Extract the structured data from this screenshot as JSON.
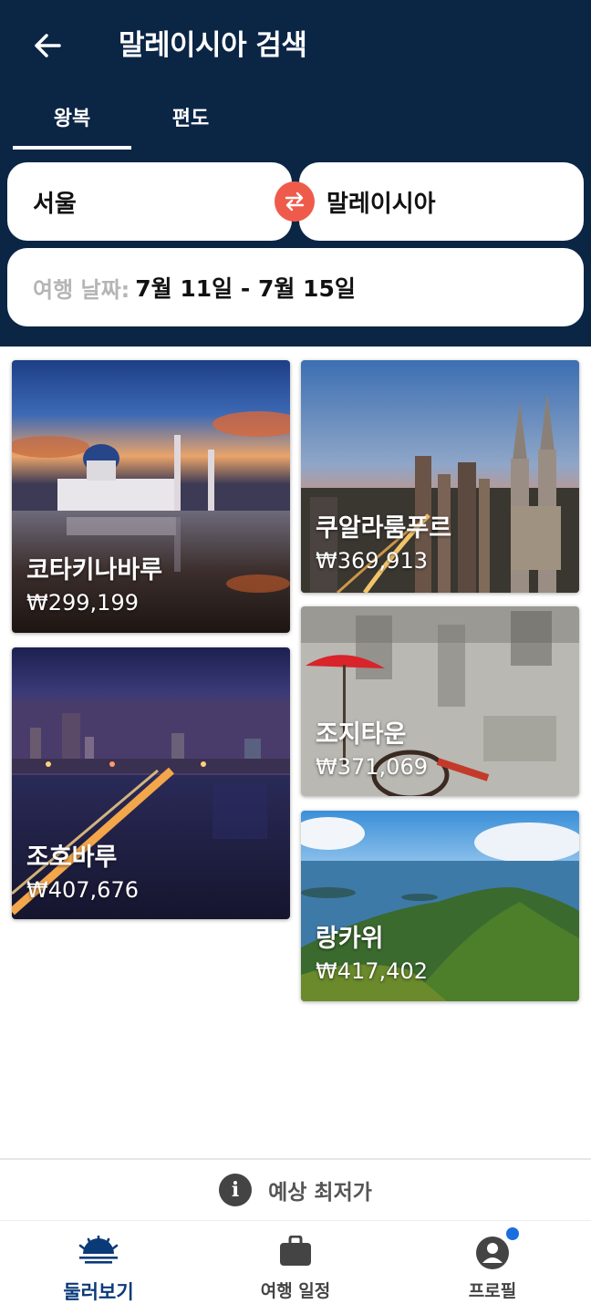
{
  "header": {
    "title": "말레이시아 검색",
    "tabs": [
      {
        "label": "왕복",
        "selected": true
      },
      {
        "label": "편도",
        "selected": false
      }
    ]
  },
  "search": {
    "origin": "서울",
    "destination": "말레이시아",
    "date_label": "여행 날짜:",
    "date_value": "7월 11일 - 7월 15일"
  },
  "destinations": [
    {
      "city": "코타키나바루",
      "price": "₩299,199"
    },
    {
      "city": "쿠알라룸푸르",
      "price": "₩369,913"
    },
    {
      "city": "조호바루",
      "price": "₩407,676"
    },
    {
      "city": "조지타운",
      "price": "₩371,069"
    },
    {
      "city": "랑카위",
      "price": "₩417,402"
    }
  ],
  "estimate": {
    "icon": "i",
    "label": "예상 최저가"
  },
  "nav": {
    "items": [
      {
        "label": "둘러보기",
        "icon": "sunrise-icon",
        "active": true
      },
      {
        "label": "여행 일정",
        "icon": "briefcase-icon",
        "active": false
      },
      {
        "label": "프로필",
        "icon": "profile-icon",
        "active": false
      }
    ]
  },
  "colors": {
    "header_bg": "#0b2545",
    "swap_accent": "#ef5b4b",
    "active_nav": "#0b3a78",
    "notification_dot": "#1b6ee0"
  }
}
